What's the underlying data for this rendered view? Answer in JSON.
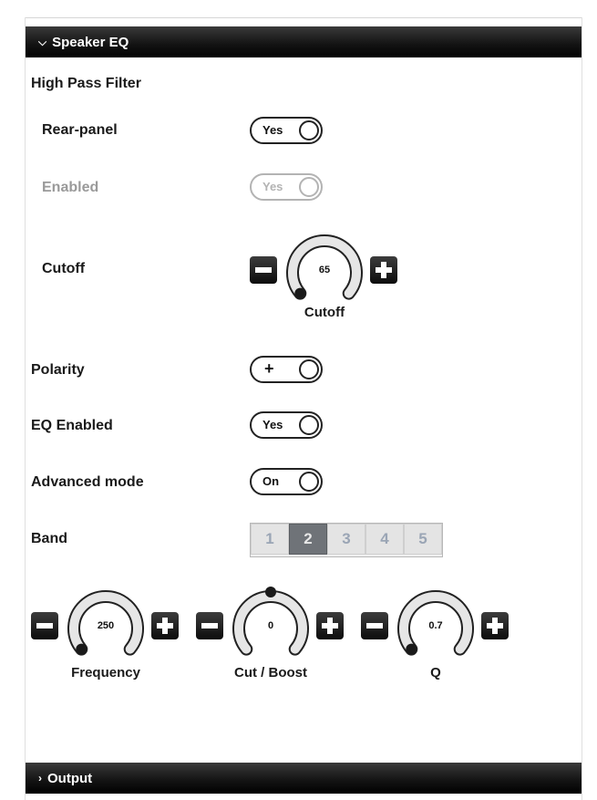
{
  "speaker_eq": {
    "title": "Speaker EQ"
  },
  "high_pass_filter": {
    "heading": "High Pass Filter",
    "rear_panel": {
      "label": "Rear-panel",
      "toggle": "Yes"
    },
    "enabled": {
      "label": "Enabled",
      "toggle": "Yes"
    },
    "cutoff": {
      "label": "Cutoff",
      "knob_value": "65",
      "knob_caption": "Cutoff"
    }
  },
  "polarity": {
    "label": "Polarity",
    "toggle": "+"
  },
  "eq_enabled": {
    "label": "EQ Enabled",
    "toggle": "Yes"
  },
  "advanced_mode": {
    "label": "Advanced mode",
    "toggle": "On"
  },
  "band": {
    "label": "Band",
    "options": [
      "1",
      "2",
      "3",
      "4",
      "5"
    ],
    "selected": "2"
  },
  "knobs": [
    {
      "value": "250",
      "caption": "Frequency"
    },
    {
      "value": "0",
      "caption": "Cut / Boost"
    },
    {
      "value": "0.7",
      "caption": "Q"
    }
  ],
  "output": {
    "title": "Output"
  },
  "colors": {
    "header_bg": "#111111",
    "band_active": "#6f7378",
    "disabled": "#b3b3b3"
  }
}
